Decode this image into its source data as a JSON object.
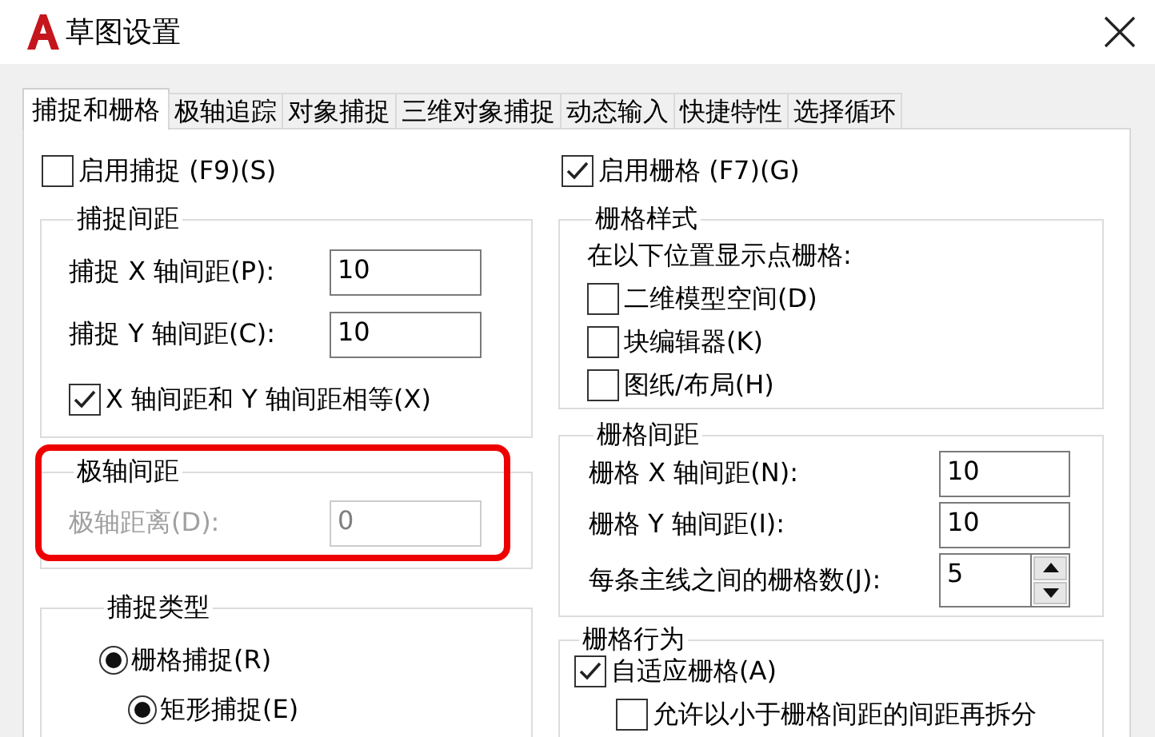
{
  "window": {
    "title": "草图设置"
  },
  "tabs": [
    {
      "label": "捕捉和栅格",
      "selected": true
    },
    {
      "label": "极轴追踪",
      "selected": false
    },
    {
      "label": "对象捕捉",
      "selected": false
    },
    {
      "label": "三维对象捕捉",
      "selected": false
    },
    {
      "label": "动态输入",
      "selected": false
    },
    {
      "label": "快捷特性",
      "selected": false
    },
    {
      "label": "选择循环",
      "selected": false
    }
  ],
  "snap_enable": {
    "label": "启用捕捉 (F9)(S)",
    "checked": false
  },
  "snap_spacing": {
    "title": "捕捉间距",
    "fields": [
      {
        "kind": "text",
        "label": "捕捉 X 轴间距(P):",
        "value": "10",
        "disabled": false
      },
      {
        "kind": "text",
        "label": "捕捉 Y 轴间距(C):",
        "value": "10",
        "disabled": false
      }
    ],
    "options": [
      {
        "kind": "checkbox",
        "label": "X 轴间距和 Y 轴间距相等(X)",
        "checked": true
      }
    ]
  },
  "polar_spacing": {
    "title": "极轴间距",
    "highlighted": true,
    "fields": [
      {
        "kind": "text",
        "label": "极轴距离(D):",
        "value": "0",
        "disabled": true
      }
    ]
  },
  "snap_type": {
    "title": "捕捉类型",
    "options": [
      {
        "kind": "radio",
        "label": "栅格捕捉(R)",
        "selected": true,
        "children": [
          {
            "kind": "radio",
            "label": "矩形捕捉(E)",
            "selected": true
          }
        ]
      }
    ]
  },
  "grid_enable": {
    "label": "启用栅格 (F7)(G)",
    "checked": true
  },
  "grid_style": {
    "title": "栅格样式",
    "caption": "在以下位置显示点栅格:",
    "options": [
      {
        "kind": "checkbox",
        "label": "二维模型空间(D)",
        "checked": false
      },
      {
        "kind": "checkbox",
        "label": "块编辑器(K)",
        "checked": false
      },
      {
        "kind": "checkbox",
        "label": "图纸/布局(H)",
        "checked": false
      }
    ]
  },
  "grid_spacing": {
    "title": "栅格间距",
    "fields": [
      {
        "kind": "text",
        "label": "栅格 X 轴间距(N):",
        "value": "10",
        "disabled": false
      },
      {
        "kind": "text",
        "label": "栅格 Y 轴间距(I):",
        "value": "10",
        "disabled": false
      },
      {
        "kind": "spinner",
        "label": "每条主线之间的栅格数(J):",
        "value": "5",
        "disabled": false
      }
    ]
  },
  "grid_behavior": {
    "title": "栅格行为",
    "options": [
      {
        "kind": "checkbox",
        "label": "自适应栅格(A)",
        "checked": true,
        "children": [
          {
            "kind": "checkbox",
            "label": "允许以小于栅格间距的间距再拆分",
            "checked": false
          }
        ]
      }
    ]
  }
}
